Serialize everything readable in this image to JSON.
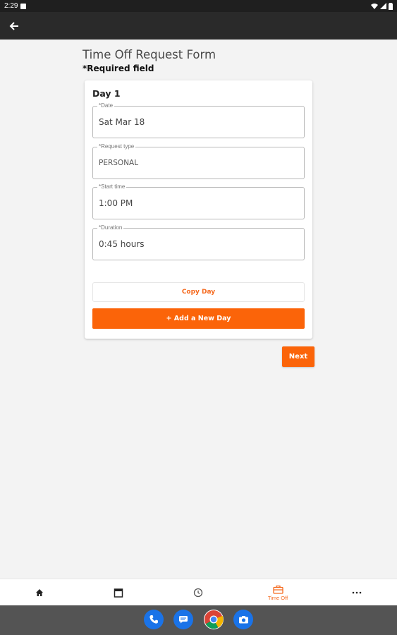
{
  "status_bar": {
    "time": "2:29"
  },
  "form": {
    "title": "Time Off Request Form",
    "required_note": "*Required field",
    "day_header": "Day 1",
    "fields": [
      {
        "label": "*Date",
        "value": "Sat Mar 18"
      },
      {
        "label": "*Request type",
        "value": "PERSONAL"
      },
      {
        "label": "*Start time",
        "value": "1:00 PM"
      },
      {
        "label": "*Duration",
        "value": "0:45 hours"
      }
    ],
    "copy_day_label": "Copy Day",
    "add_day_label": "+ Add a New Day",
    "next_label": "Next"
  },
  "bottom_nav": {
    "items": [
      {
        "icon": "home-icon",
        "label": ""
      },
      {
        "icon": "calendar-icon",
        "label": ""
      },
      {
        "icon": "clock-icon",
        "label": ""
      },
      {
        "icon": "briefcase-icon",
        "label": "Time Off",
        "active": true
      },
      {
        "icon": "more-icon",
        "label": ""
      }
    ]
  },
  "dock": {
    "apps": [
      "phone-icon",
      "messages-icon",
      "chrome-icon",
      "camera-icon"
    ]
  },
  "colors": {
    "accent": "#fb6409",
    "appbar": "#2a2a2a",
    "statusbar": "#1f1f1f",
    "background": "#f3f3f3"
  }
}
